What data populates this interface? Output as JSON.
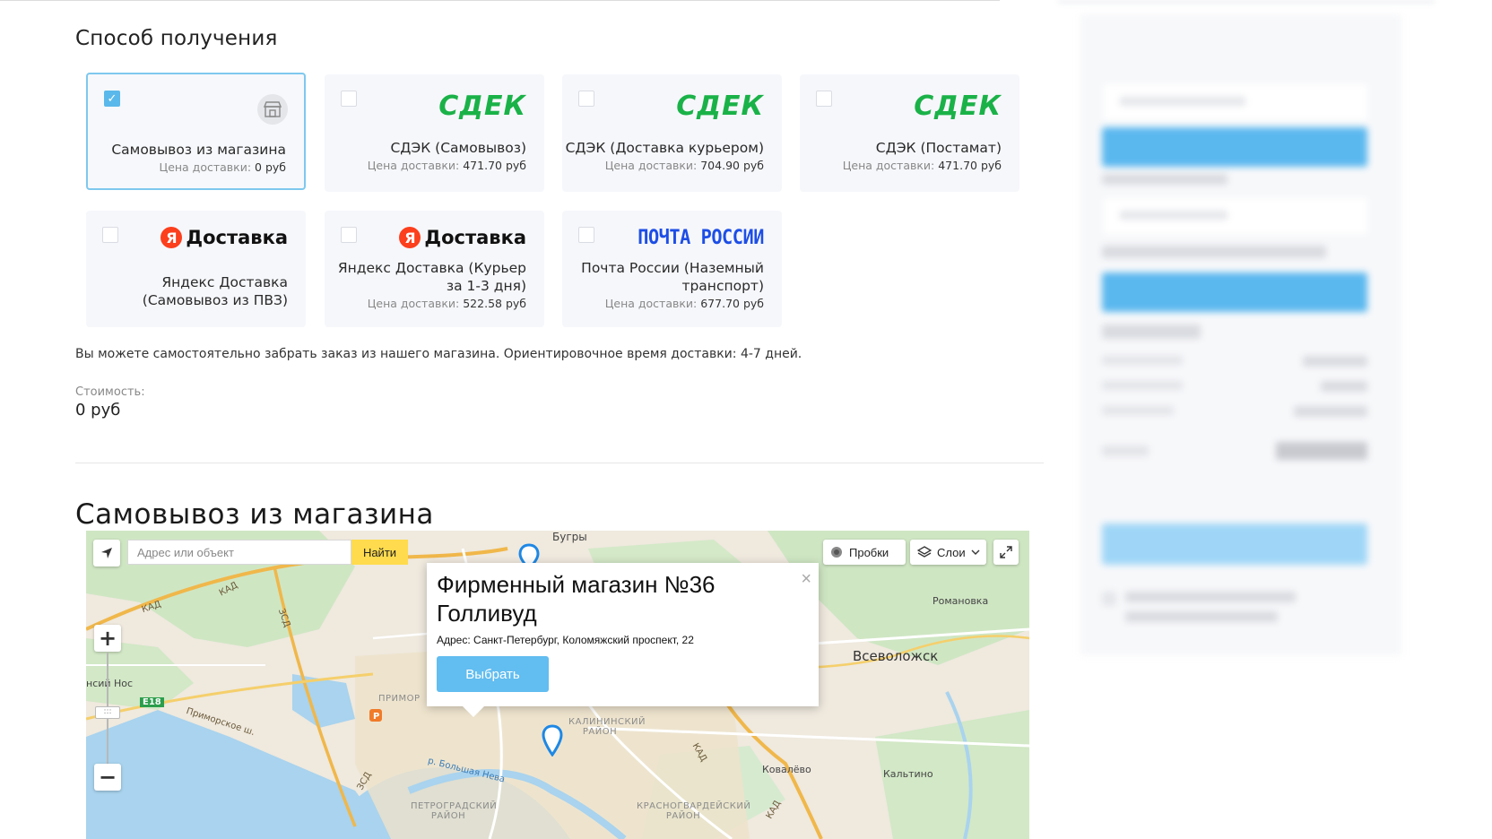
{
  "delivery": {
    "heading": "Способ получения",
    "options": [
      {
        "title": "Самовывоз из магазина",
        "price_label": "Цена доставки:",
        "price": "0 руб",
        "checked": true,
        "logo": "store-icon"
      },
      {
        "title": "СДЭК (Самовывоз)",
        "price_label": "Цена доставки:",
        "price": "471.70 руб",
        "checked": false,
        "logo": "СДЕК"
      },
      {
        "title": "СДЭК (Доставка курьером)",
        "price_label": "Цена доставки:",
        "price": "704.90 руб",
        "checked": false,
        "logo": "СДЕК"
      },
      {
        "title": "СДЭК (Постамат)",
        "price_label": "Цена доставки:",
        "price": "471.70 руб",
        "checked": false,
        "logo": "СДЕК"
      },
      {
        "title": "Яндекс Доставка (Самовывоз из ПВЗ)",
        "price_label": "",
        "price": "",
        "checked": false,
        "logo": "Доставка",
        "logo_letter": "Я"
      },
      {
        "title": "Яндекс Доставка (Курьер за 1-3 дня)",
        "price_label": "Цена доставки:",
        "price": "522.58 руб",
        "checked": false,
        "logo": "Доставка",
        "logo_letter": "Я"
      },
      {
        "title": "Почта России (Наземный транспорт)",
        "price_label": "Цена доставки:",
        "price": "677.70 руб",
        "checked": false,
        "logo": "ПОЧТА РОССИИ"
      }
    ],
    "note": "Вы можете самостоятельно забрать заказ из нашего магазина. Ориентировочное время доставки: 4-7 дней.",
    "cost_label": "Стоимость:",
    "cost_value": "0 руб"
  },
  "pickup": {
    "heading": "Самовывоз из магазина",
    "map": {
      "search_placeholder": "Адрес или объект",
      "find_label": "Найти",
      "traffic_label": "Пробки",
      "layers_label": "Слои",
      "zoom_in": "+",
      "zoom_out": "−",
      "labels": {
        "bugry": "Бугры",
        "romanovka": "Романовка",
        "vsevolozhsk": "Всеволожск",
        "kovalevo": "Ковалёво",
        "kaltino": "Кальтино",
        "nos": "нсий Нос",
        "kad1": "КАД",
        "kad2": "КАД",
        "kad3": "КАД",
        "kad4": "КАД",
        "zsd1": "ЗСД",
        "zsd2": "ЗСД",
        "e18": "E18",
        "primorskoe": "Приморское ш.",
        "neva": "р. Большая Нева",
        "primor_rayon": "ПРИМОР",
        "kalininsky": "КАЛИНИНСКИЙ РАЙОН",
        "petrogradsky": "ПЕТРОГРАДСКИЙ РАЙОН",
        "krasnogvard": "КРАСНОГВАРДЕЙСКИЙ РАЙОН"
      },
      "balloon": {
        "title": "Фирменный магазин №36 Голливуд",
        "address": "Адрес: Санкт-Петербург, Коломяжский проспект, 22",
        "button": "Выбрать",
        "close": "×"
      }
    }
  },
  "colors": {
    "accent": "#5bb8ea",
    "cdek_green": "#1ab248",
    "yandex_red": "#fc3f1d",
    "pochta_blue": "#1d4ee6",
    "find_yellow": "#ffdb4d"
  }
}
